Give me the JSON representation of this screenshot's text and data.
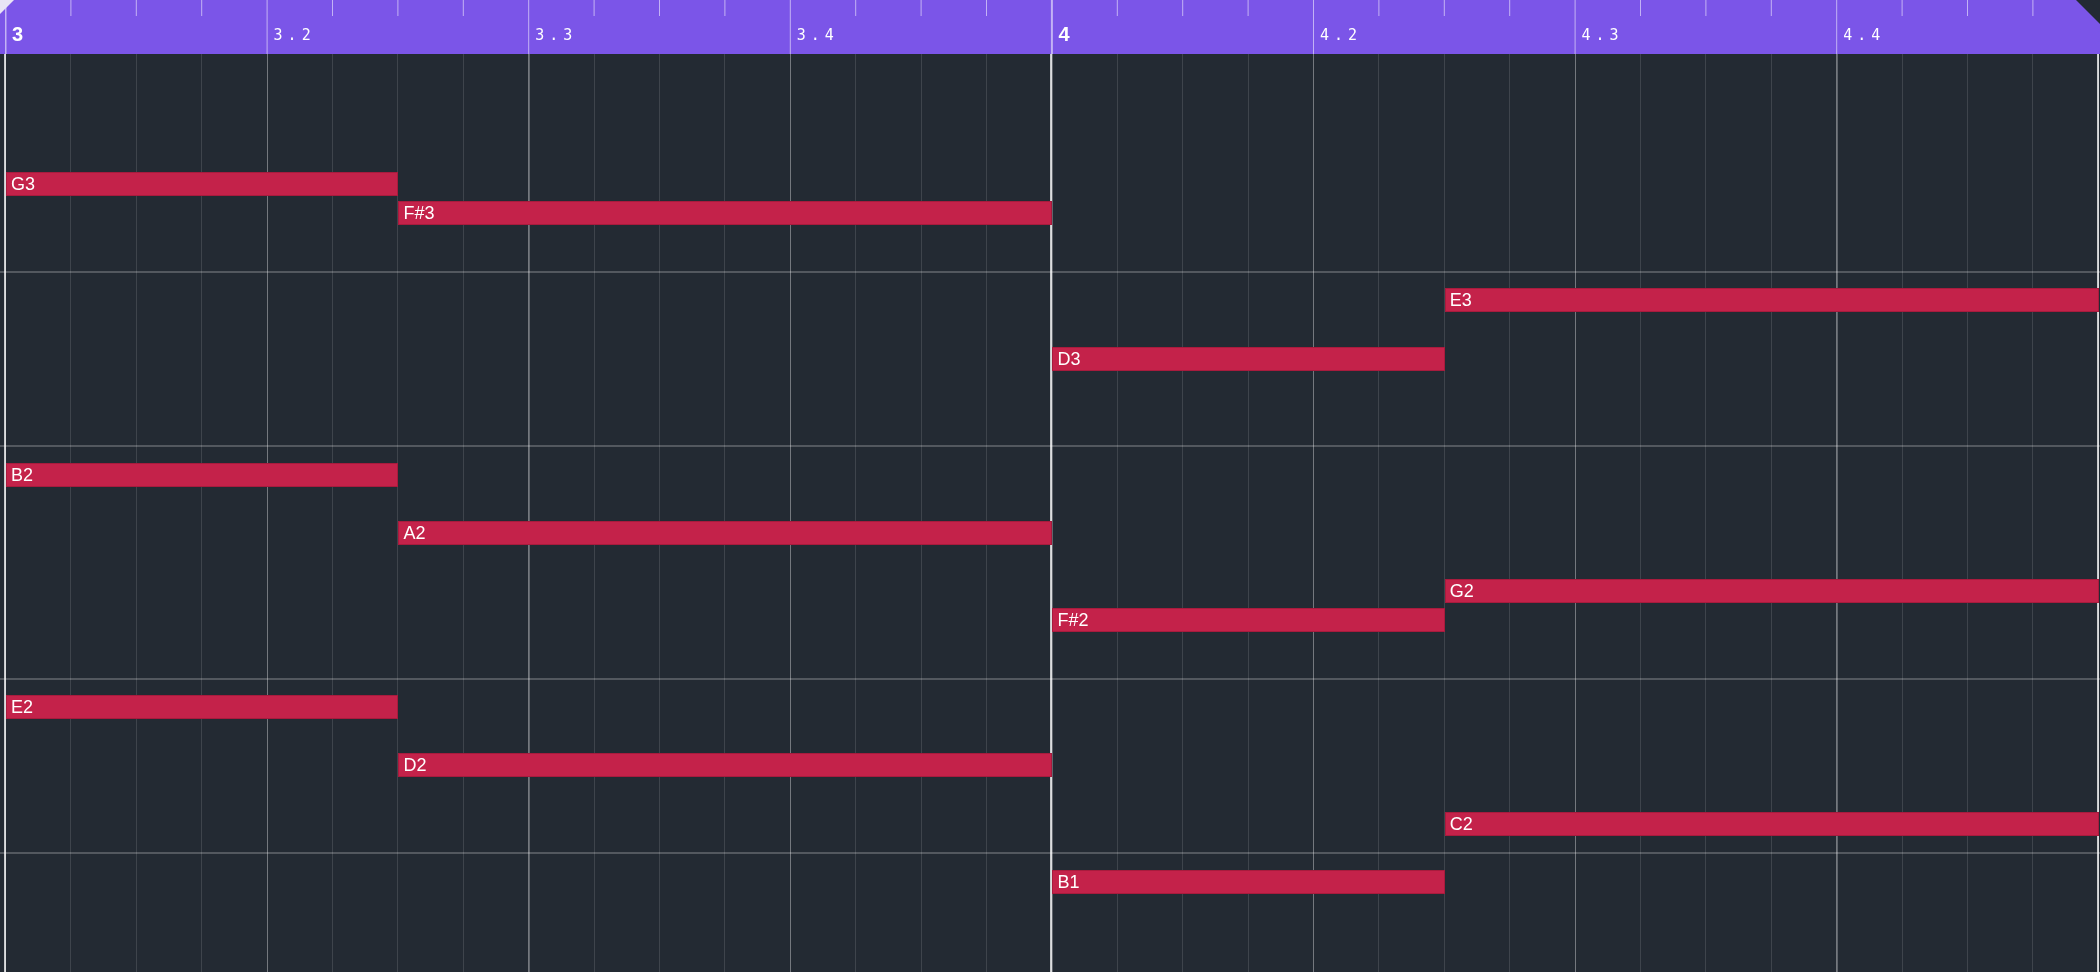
{
  "ruler": {
    "marks": [
      {
        "label": "3",
        "kind": "bar"
      },
      {
        "label": "3.2",
        "kind": "beat"
      },
      {
        "label": "3.3",
        "kind": "beat"
      },
      {
        "label": "3.4",
        "kind": "beat"
      },
      {
        "label": "4",
        "kind": "bar"
      },
      {
        "label": "4.2",
        "kind": "beat"
      },
      {
        "label": "4.3",
        "kind": "beat"
      },
      {
        "label": "4.4",
        "kind": "beat"
      }
    ]
  },
  "notes": [
    {
      "label": "G3"
    },
    {
      "label": "F#3"
    },
    {
      "label": "E3"
    },
    {
      "label": "D3"
    },
    {
      "label": "B2"
    },
    {
      "label": "A2"
    },
    {
      "label": "G2"
    },
    {
      "label": "F#2"
    },
    {
      "label": "E2"
    },
    {
      "label": "D2"
    },
    {
      "label": "C2"
    },
    {
      "label": "B1"
    }
  ]
}
